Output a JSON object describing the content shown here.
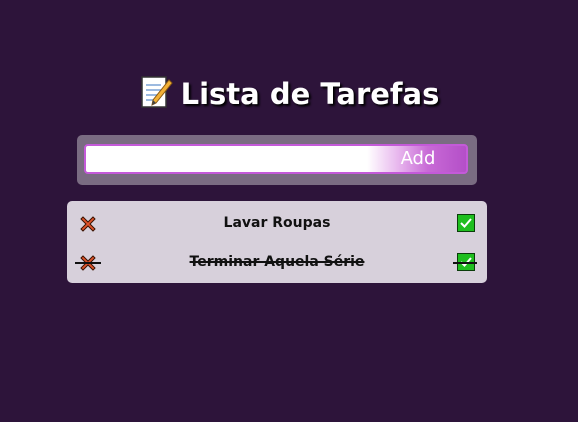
{
  "header": {
    "title": "Lista de Tarefas",
    "icon": "memo-icon"
  },
  "form": {
    "input_value": "",
    "input_placeholder": "",
    "add_label": "Add"
  },
  "tasks": [
    {
      "text": "Lavar Roupas",
      "done": false
    },
    {
      "text": "Terminar Aquela Série",
      "done": true
    }
  ],
  "colors": {
    "background": "#2d143a",
    "form_box": "#7a6c82",
    "input_border": "#c45ad9",
    "add_button_gradient_end": "#b44fc8",
    "list_box": "#d7d0db",
    "delete_icon": "#e0532b",
    "check_icon": "#1fbe1f"
  }
}
